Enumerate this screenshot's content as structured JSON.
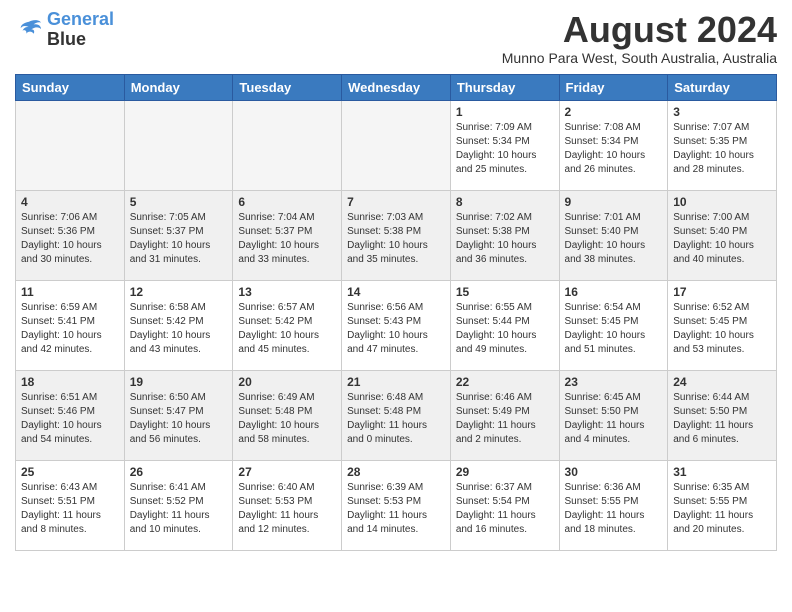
{
  "header": {
    "logo_line1": "General",
    "logo_line2": "Blue",
    "month": "August 2024",
    "location": "Munno Para West, South Australia, Australia"
  },
  "days_of_week": [
    "Sunday",
    "Monday",
    "Tuesday",
    "Wednesday",
    "Thursday",
    "Friday",
    "Saturday"
  ],
  "weeks": [
    [
      {
        "day": "",
        "empty": true
      },
      {
        "day": "",
        "empty": true
      },
      {
        "day": "",
        "empty": true
      },
      {
        "day": "",
        "empty": true
      },
      {
        "day": "1",
        "sunrise": "7:09 AM",
        "sunset": "5:34 PM",
        "daylight": "10 hours and 25 minutes."
      },
      {
        "day": "2",
        "sunrise": "7:08 AM",
        "sunset": "5:34 PM",
        "daylight": "10 hours and 26 minutes."
      },
      {
        "day": "3",
        "sunrise": "7:07 AM",
        "sunset": "5:35 PM",
        "daylight": "10 hours and 28 minutes."
      }
    ],
    [
      {
        "day": "4",
        "sunrise": "7:06 AM",
        "sunset": "5:36 PM",
        "daylight": "10 hours and 30 minutes."
      },
      {
        "day": "5",
        "sunrise": "7:05 AM",
        "sunset": "5:37 PM",
        "daylight": "10 hours and 31 minutes."
      },
      {
        "day": "6",
        "sunrise": "7:04 AM",
        "sunset": "5:37 PM",
        "daylight": "10 hours and 33 minutes."
      },
      {
        "day": "7",
        "sunrise": "7:03 AM",
        "sunset": "5:38 PM",
        "daylight": "10 hours and 35 minutes."
      },
      {
        "day": "8",
        "sunrise": "7:02 AM",
        "sunset": "5:38 PM",
        "daylight": "10 hours and 36 minutes."
      },
      {
        "day": "9",
        "sunrise": "7:01 AM",
        "sunset": "5:40 PM",
        "daylight": "10 hours and 38 minutes."
      },
      {
        "day": "10",
        "sunrise": "7:00 AM",
        "sunset": "5:40 PM",
        "daylight": "10 hours and 40 minutes."
      }
    ],
    [
      {
        "day": "11",
        "sunrise": "6:59 AM",
        "sunset": "5:41 PM",
        "daylight": "10 hours and 42 minutes."
      },
      {
        "day": "12",
        "sunrise": "6:58 AM",
        "sunset": "5:42 PM",
        "daylight": "10 hours and 43 minutes."
      },
      {
        "day": "13",
        "sunrise": "6:57 AM",
        "sunset": "5:42 PM",
        "daylight": "10 hours and 45 minutes."
      },
      {
        "day": "14",
        "sunrise": "6:56 AM",
        "sunset": "5:43 PM",
        "daylight": "10 hours and 47 minutes."
      },
      {
        "day": "15",
        "sunrise": "6:55 AM",
        "sunset": "5:44 PM",
        "daylight": "10 hours and 49 minutes."
      },
      {
        "day": "16",
        "sunrise": "6:54 AM",
        "sunset": "5:45 PM",
        "daylight": "10 hours and 51 minutes."
      },
      {
        "day": "17",
        "sunrise": "6:52 AM",
        "sunset": "5:45 PM",
        "daylight": "10 hours and 53 minutes."
      }
    ],
    [
      {
        "day": "18",
        "sunrise": "6:51 AM",
        "sunset": "5:46 PM",
        "daylight": "10 hours and 54 minutes."
      },
      {
        "day": "19",
        "sunrise": "6:50 AM",
        "sunset": "5:47 PM",
        "daylight": "10 hours and 56 minutes."
      },
      {
        "day": "20",
        "sunrise": "6:49 AM",
        "sunset": "5:48 PM",
        "daylight": "10 hours and 58 minutes."
      },
      {
        "day": "21",
        "sunrise": "6:48 AM",
        "sunset": "5:48 PM",
        "daylight": "11 hours and 0 minutes."
      },
      {
        "day": "22",
        "sunrise": "6:46 AM",
        "sunset": "5:49 PM",
        "daylight": "11 hours and 2 minutes."
      },
      {
        "day": "23",
        "sunrise": "6:45 AM",
        "sunset": "5:50 PM",
        "daylight": "11 hours and 4 minutes."
      },
      {
        "day": "24",
        "sunrise": "6:44 AM",
        "sunset": "5:50 PM",
        "daylight": "11 hours and 6 minutes."
      }
    ],
    [
      {
        "day": "25",
        "sunrise": "6:43 AM",
        "sunset": "5:51 PM",
        "daylight": "11 hours and 8 minutes."
      },
      {
        "day": "26",
        "sunrise": "6:41 AM",
        "sunset": "5:52 PM",
        "daylight": "11 hours and 10 minutes."
      },
      {
        "day": "27",
        "sunrise": "6:40 AM",
        "sunset": "5:53 PM",
        "daylight": "11 hours and 12 minutes."
      },
      {
        "day": "28",
        "sunrise": "6:39 AM",
        "sunset": "5:53 PM",
        "daylight": "11 hours and 14 minutes."
      },
      {
        "day": "29",
        "sunrise": "6:37 AM",
        "sunset": "5:54 PM",
        "daylight": "11 hours and 16 minutes."
      },
      {
        "day": "30",
        "sunrise": "6:36 AM",
        "sunset": "5:55 PM",
        "daylight": "11 hours and 18 minutes."
      },
      {
        "day": "31",
        "sunrise": "6:35 AM",
        "sunset": "5:55 PM",
        "daylight": "11 hours and 20 minutes."
      }
    ]
  ]
}
